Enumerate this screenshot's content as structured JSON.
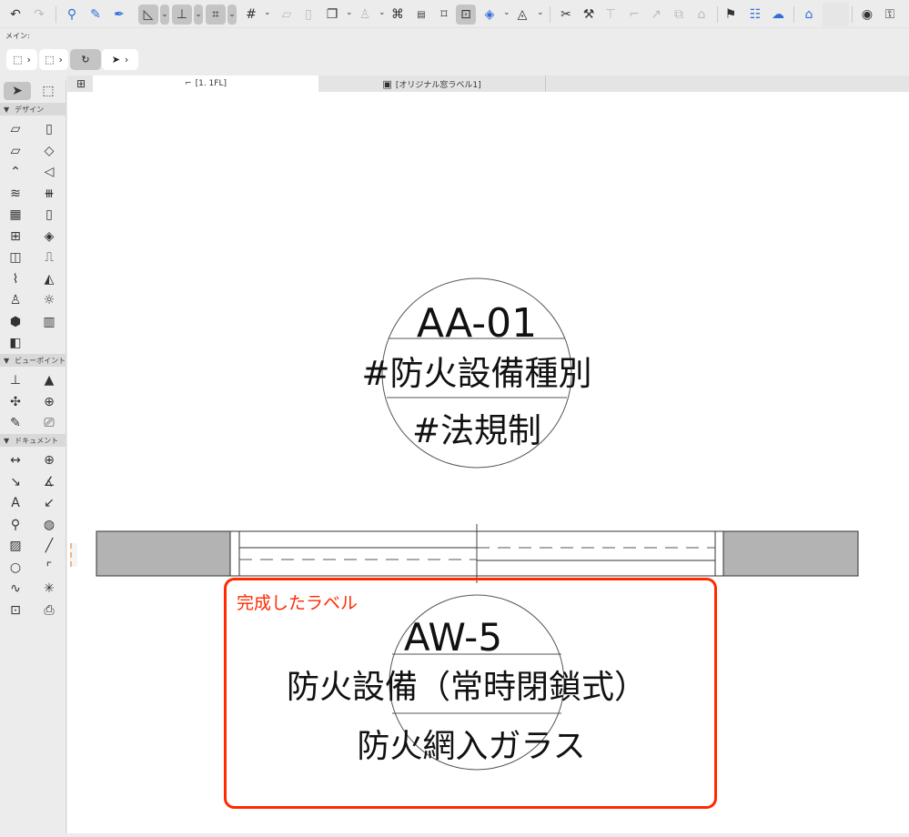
{
  "toolbar": {
    "icons": [
      "undo-icon",
      "redo-icon",
      "pick-up-icon",
      "eyedropper-icon",
      "inject-icon",
      "guide-icon",
      "snap-guide-icon",
      "coordinate-icon",
      "grid-snap-icon",
      "plane-icon",
      "plane-vertical-icon",
      "layer-outline-icon",
      "lock-icon",
      "trace-icon",
      "ruler-icon",
      "center-icon",
      "edit-nodes-icon",
      "fill-icon",
      "shape-icon",
      "split-icon",
      "adjust-icon",
      "elevate-icon",
      "offset-icon",
      "curve-icon",
      "resize-icon",
      "roof-icon",
      "flag-icon",
      "schedule-icon",
      "cloud-icon",
      "house-check-icon",
      "visibility-icon",
      "lock-unlock-icon"
    ]
  },
  "main_label": "メイン:",
  "tabs": [
    {
      "label": "[1. 1FL]"
    },
    {
      "label": "[オリジナル窓ラベル1]"
    }
  ],
  "sidebar": {
    "sections": [
      {
        "label": "デザイン"
      },
      {
        "label": "ビューポイント"
      },
      {
        "label": "ドキュメント"
      }
    ]
  },
  "drawing": {
    "label1": {
      "line1": "AA-01",
      "line2": "#防火設備種別",
      "line3": "#法規制"
    },
    "label2": {
      "line1": "AW-5",
      "line2": "防火設備（常時閉鎖式）",
      "line3": "防火網入ガラス"
    },
    "annotation": "完成したラベル",
    "annotation_color": "#ff2a00"
  }
}
